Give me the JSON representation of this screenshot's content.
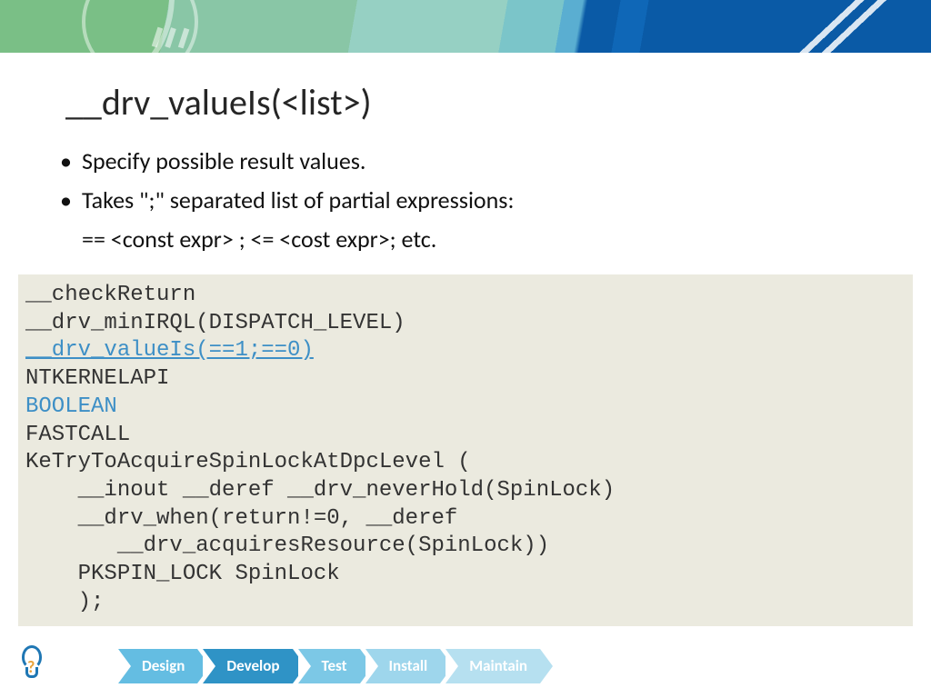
{
  "title": "__drv_valueIs(<list>)",
  "bullets": [
    "Specify possible result values.",
    "Takes \";\" separated list of partial expressions:"
  ],
  "subline": "== <const expr> ; <= <cost expr>; etc.",
  "code": {
    "l1": "__checkReturn",
    "l2": "__drv_minIRQL(DISPATCH_LEVEL)",
    "l3": "__drv_valueIs(==1;==0)",
    "l4": "NTKERNELAPI",
    "l5": "BOOLEAN",
    "l6": "FASTCALL",
    "l7": "KeTryToAcquireSpinLockAtDpcLevel (",
    "l8": "    __inout __deref __drv_neverHold(SpinLock)",
    "l9": "    __drv_when(return!=0, __deref",
    "l10": "       __drv_acquiresResource(SpinLock))",
    "l11": "    PKSPIN_LOCK SpinLock",
    "l12": "    );"
  },
  "footer": {
    "steps": [
      "Design",
      "Develop",
      "Test",
      "Install",
      "Maintain"
    ]
  }
}
